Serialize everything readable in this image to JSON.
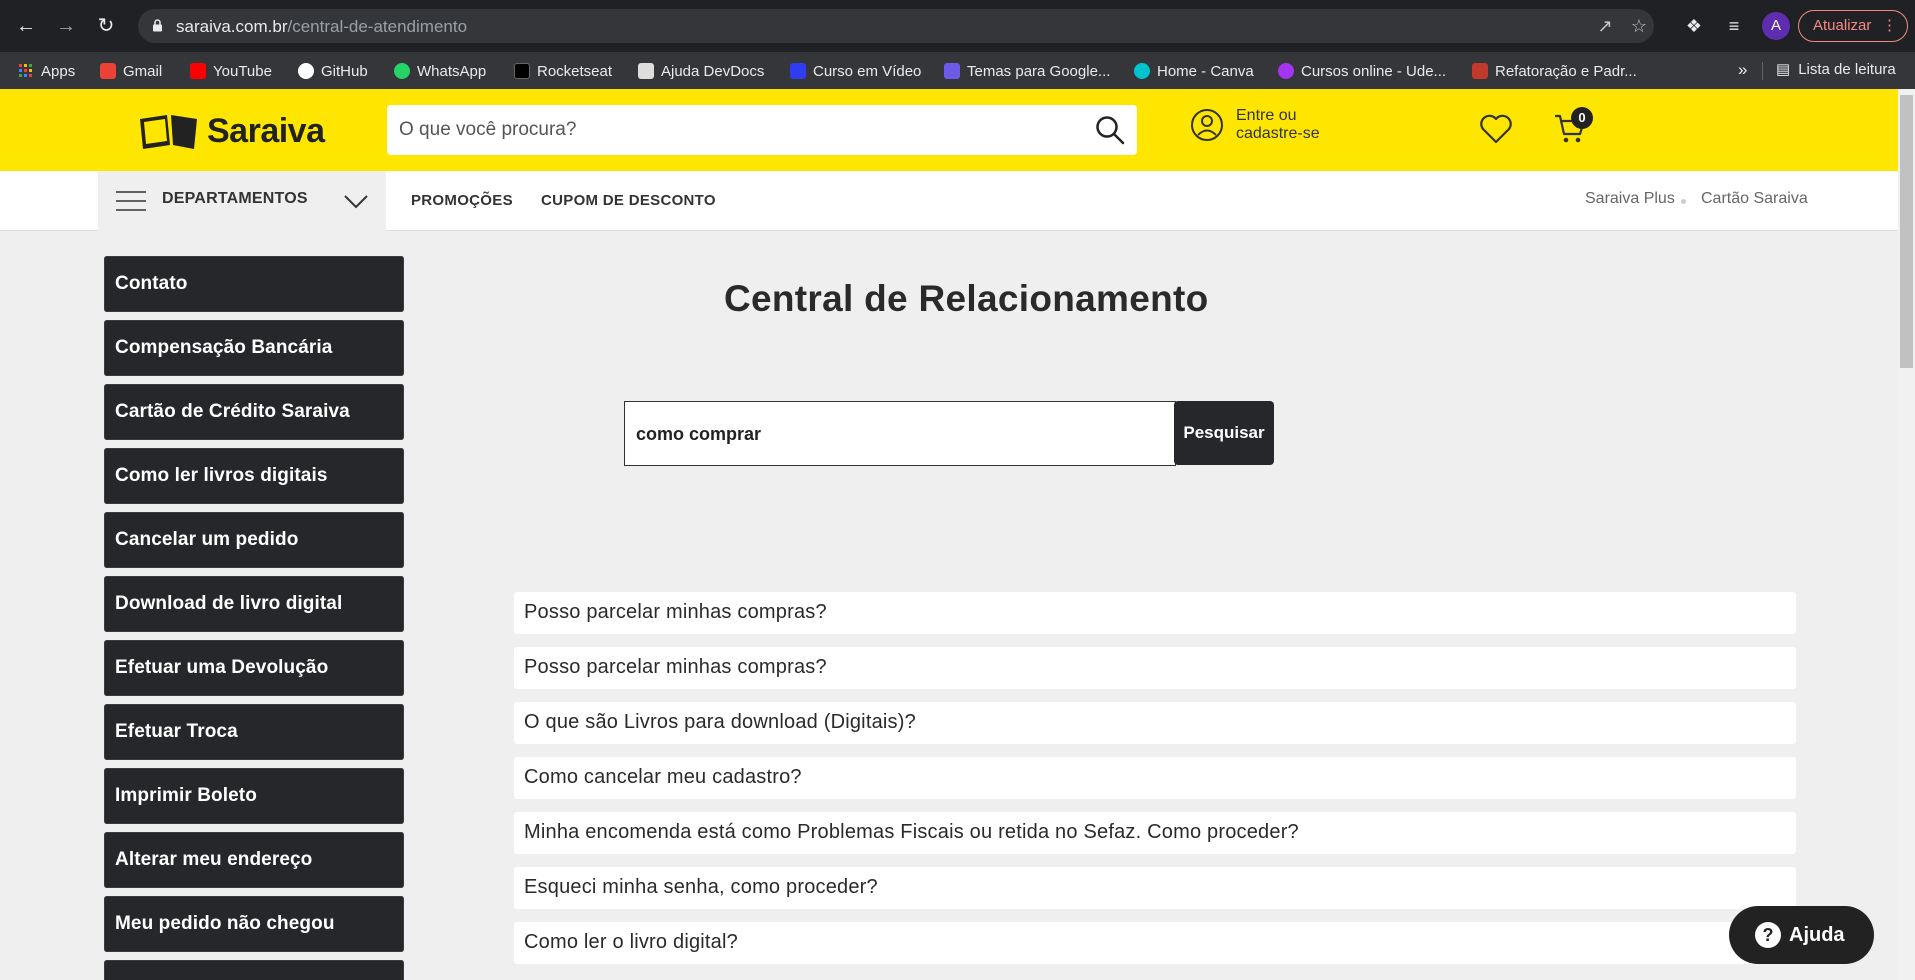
{
  "browser": {
    "url_domain": "saraiva.com.br",
    "url_path": "/central-de-atendimento",
    "profile_initial": "A",
    "update_label": "Atualizar",
    "bookmarks": [
      {
        "label": "Apps",
        "icon": "apps-grid-icon",
        "color": "#ea4335"
      },
      {
        "label": "Gmail",
        "icon": "gmail-icon",
        "color": "#ea4335"
      },
      {
        "label": "YouTube",
        "icon": "youtube-icon",
        "color": "#ff0000"
      },
      {
        "label": "GitHub",
        "icon": "github-icon",
        "color": "#ffffff"
      },
      {
        "label": "WhatsApp",
        "icon": "whatsapp-icon",
        "color": "#25d366"
      },
      {
        "label": "Rocketseat",
        "icon": "rocketseat-icon",
        "color": "#000000"
      },
      {
        "label": "Ajuda DevDocs",
        "icon": "devdocs-icon",
        "color": "#dddddd"
      },
      {
        "label": "Curso em Vídeo",
        "icon": "cursoemvideo-icon",
        "color": "#2f3cf0"
      },
      {
        "label": "Temas para Google...",
        "icon": "themes-icon",
        "color": "#6b5ce7"
      },
      {
        "label": "Home - Canva",
        "icon": "canva-icon",
        "color": "#00c4cc"
      },
      {
        "label": "Cursos online - Ude...",
        "icon": "udemy-icon",
        "color": "#a435f0"
      },
      {
        "label": "Refatoração e Padr...",
        "icon": "refactoring-icon",
        "color": "#c0392b"
      }
    ],
    "more_label": "»",
    "reading_list_label": "Lista de leitura"
  },
  "header": {
    "logo_text": "Saraiva",
    "search_placeholder": "O que você procura?",
    "login_line1": "Entre ou",
    "login_line2": "cadastre-se",
    "cart_count": "0",
    "brand_color": "#fee600"
  },
  "nav": {
    "departments": "DEPARTAMENTOS",
    "links": [
      "PROMOÇÕES",
      "CUPOM DE DESCONTO"
    ],
    "right_links": [
      "Saraiva Plus",
      "Cartão Saraiva"
    ]
  },
  "sidebar": {
    "items": [
      "Contato",
      "Compensação Bancária",
      "Cartão de Crédito Saraiva",
      "Como ler livros digitais",
      "Cancelar um pedido",
      "Download de livro digital",
      "Efetuar uma Devolução",
      "Efetuar Troca",
      "Imprimir Boleto",
      "Alterar meu endereço",
      "Meu pedido não chegou"
    ]
  },
  "main": {
    "title": "Central de Relacionamento",
    "search_value": "como comprar",
    "search_button": "Pesquisar",
    "faq": [
      "Posso parcelar minhas compras?",
      "Posso parcelar minhas compras?",
      "O que são Livros para download (Digitais)?",
      "Como cancelar meu cadastro?",
      "Minha encomenda está como Problemas Fiscais ou retida no Sefaz. Como proceder?",
      "Esqueci minha senha, como proceder?",
      "Como ler o livro digital?"
    ],
    "help_label": "Ajuda"
  }
}
